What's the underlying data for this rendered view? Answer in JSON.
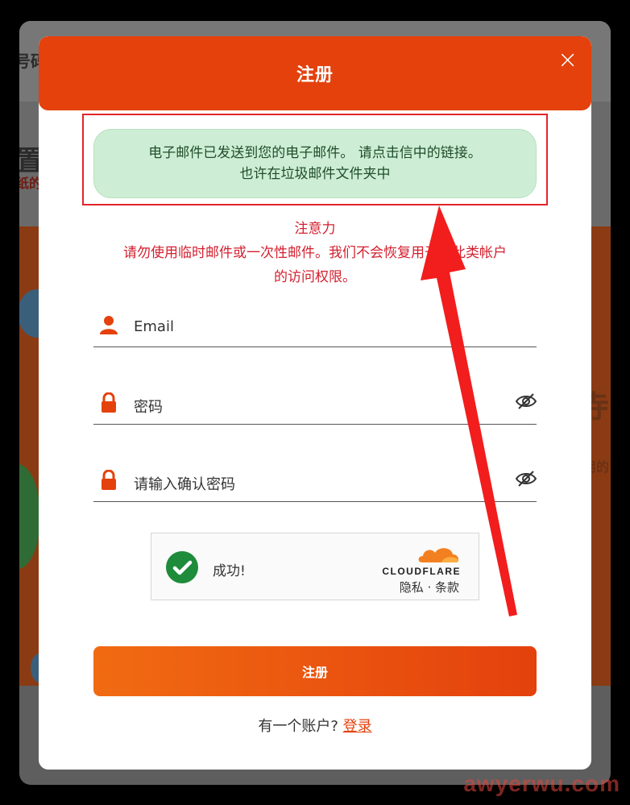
{
  "modal": {
    "title": "注册",
    "close_label": "×"
  },
  "notice": {
    "line1": "电子邮件已发送到您的电子邮件。 请点击信中的链接。",
    "line2": "也许在垃圾邮件文件夹中"
  },
  "attention": {
    "title": "注意力",
    "line1": "请勿使用临时邮件或一次性邮件。我们不会恢复用于对此类帐户",
    "line2": "的访问权限。"
  },
  "form": {
    "email_placeholder": "Email",
    "password_placeholder": "密码",
    "confirm_placeholder": "请输入确认密码",
    "user_icon": "user-icon",
    "lock_icon": "lock-icon",
    "eye_icon": "eye-slash-icon"
  },
  "captcha": {
    "status": "成功!",
    "brand": "CLOUDFLARE",
    "links": "隐私 · 条款",
    "check_icon": "check-circle-icon"
  },
  "submit_label": "注册",
  "login": {
    "prompt": "有一个账户?",
    "link": "登录"
  },
  "background": {
    "top_left_text": "号码",
    "mid_left_text": "置",
    "mid_left_sub": "纸的",
    "right_text": "寺",
    "right_sub": "用的"
  },
  "watermark": "awyerwu.com",
  "colors": {
    "brand_orange": "#e4410d",
    "success_green": "#cdeed4",
    "warning_red": "#d3202f"
  }
}
